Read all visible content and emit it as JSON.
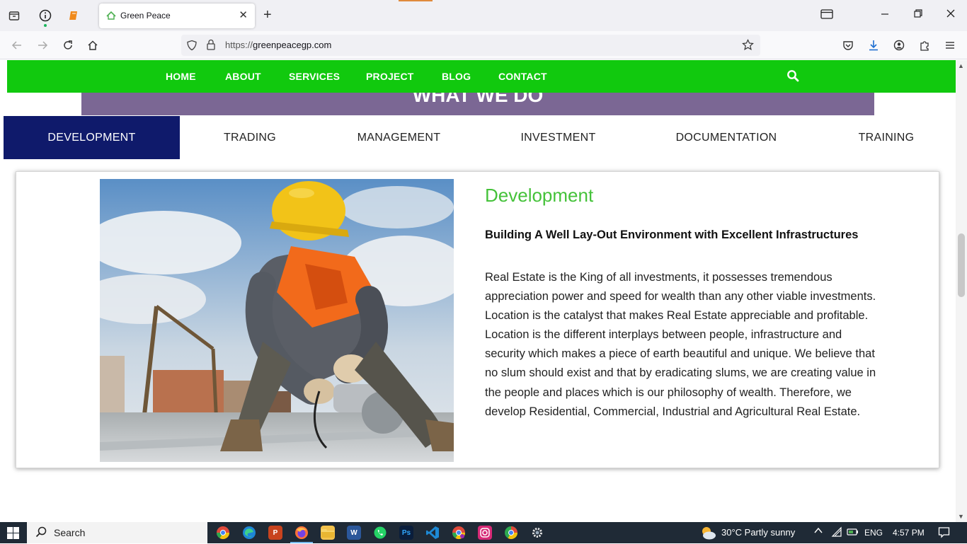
{
  "browser": {
    "tab_title": "Green Peace",
    "url_prefix": "https://",
    "url_domain": "greenpeacegp.com"
  },
  "site": {
    "nav": [
      "HOME",
      "ABOUT",
      "SERVICES",
      "PROJECT",
      "BLOG",
      "CONTACT"
    ],
    "section_title": "WHAT WE DO",
    "tabs": [
      "DEVELOPMENT",
      "TRADING",
      "MANAGEMENT",
      "INVESTMENT",
      "DOCUMENTATION",
      "TRAINING"
    ],
    "active_tab": "DEVELOPMENT",
    "panel": {
      "heading": "Development",
      "subheading": "Building A Well Lay-Out Environment with Excellent Infrastructures",
      "body": "Real Estate is the King of all investments, it possesses tremendous appreciation power and speed for wealth than any other viable investments. Location is the catalyst that makes Real Estate appreciable and profitable. Location is the different interplays between people, infrastructure and security which makes a piece of earth beautiful and unique. We believe that no slum should exist and that by eradicating slums, we are creating value in the people and places which is our philosophy of wealth. Therefore, we develop Residential, Commercial, Industrial and Agricultural Real Estate."
    }
  },
  "taskbar": {
    "search_label": "Search",
    "weather": "30°C  Partly sunny",
    "language": "ENG",
    "time": "4:57 PM"
  },
  "colors": {
    "nav_green": "#11c90e",
    "band_purple": "#7b6794",
    "active_tab_navy": "#0f1a6b",
    "heading_green": "#45c23a"
  }
}
